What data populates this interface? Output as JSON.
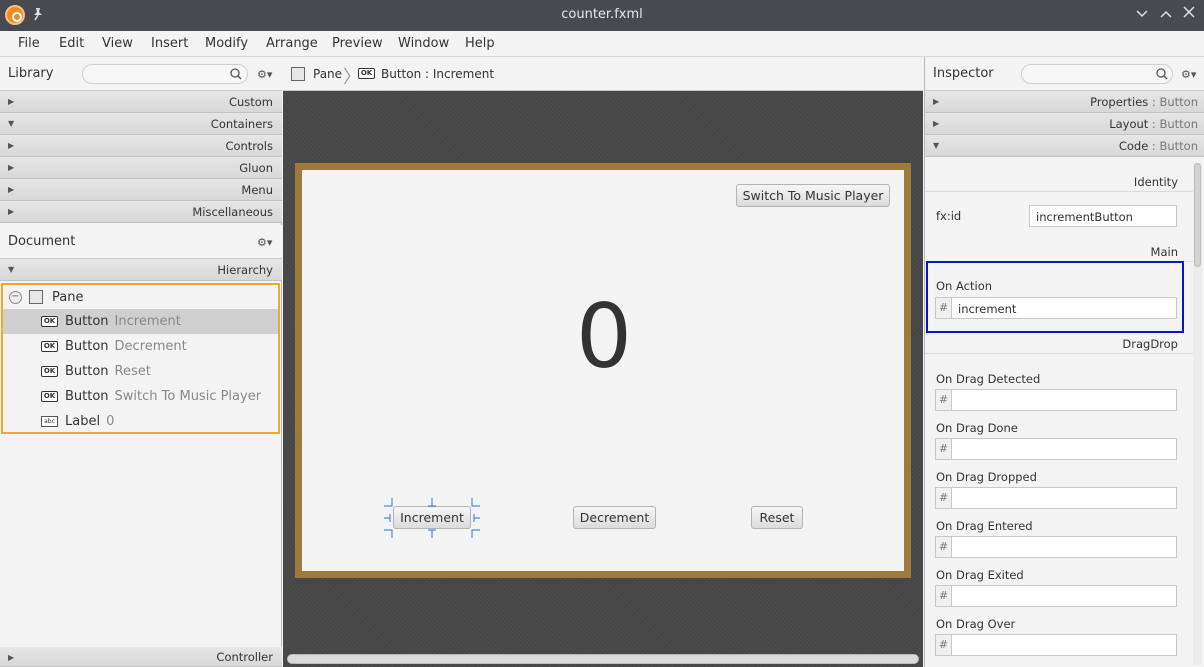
{
  "window": {
    "title": "counter.fxml"
  },
  "menu": [
    "File",
    "Edit",
    "View",
    "Insert",
    "Modify",
    "Arrange",
    "Preview",
    "Window",
    "Help"
  ],
  "library": {
    "title": "Library",
    "sections": [
      "Custom",
      "Containers",
      "Controls",
      "Gluon",
      "Menu",
      "Miscellaneous"
    ]
  },
  "document": {
    "title": "Document",
    "hierarchy_label": "Hierarchy",
    "root": "Pane",
    "items": [
      {
        "type": "Button",
        "value": "Increment",
        "icon": "ok-button-icon"
      },
      {
        "type": "Button",
        "value": "Decrement",
        "icon": "ok-button-icon"
      },
      {
        "type": "Button",
        "value": "Reset",
        "icon": "ok-button-icon"
      },
      {
        "type": "Button",
        "value": "Switch To Music Player",
        "icon": "ok-button-icon"
      },
      {
        "type": "Label",
        "value": "0",
        "icon": "abc-label-icon"
      }
    ],
    "controller_label": "Controller"
  },
  "breadcrumb": {
    "pane": "Pane",
    "selected": "Button : Increment"
  },
  "canvas": {
    "switch_button": "Switch To Music Player",
    "counter_value": "0",
    "increment_button": "Increment",
    "decrement_button": "Decrement",
    "reset_button": "Reset",
    "frame_color": "#a07a3c",
    "selection_color": "#2b6fd6"
  },
  "inspector": {
    "title": "Inspector",
    "sections": [
      {
        "name": "Properties",
        "sub": "Button"
      },
      {
        "name": "Layout",
        "sub": "Button"
      },
      {
        "name": "Code",
        "sub": "Button"
      }
    ],
    "identity_label": "Identity",
    "fxid_label": "fx:id",
    "fxid_value": "incrementButton",
    "main_label": "Main",
    "on_action_label": "On Action",
    "on_action_value": "increment",
    "hash": "#",
    "dragdrop_label": "DragDrop",
    "drag_fields": [
      "On Drag Detected",
      "On Drag Done",
      "On Drag Dropped",
      "On Drag Entered",
      "On Drag Exited",
      "On Drag Over"
    ],
    "highlight_color": "#0a14c8"
  }
}
